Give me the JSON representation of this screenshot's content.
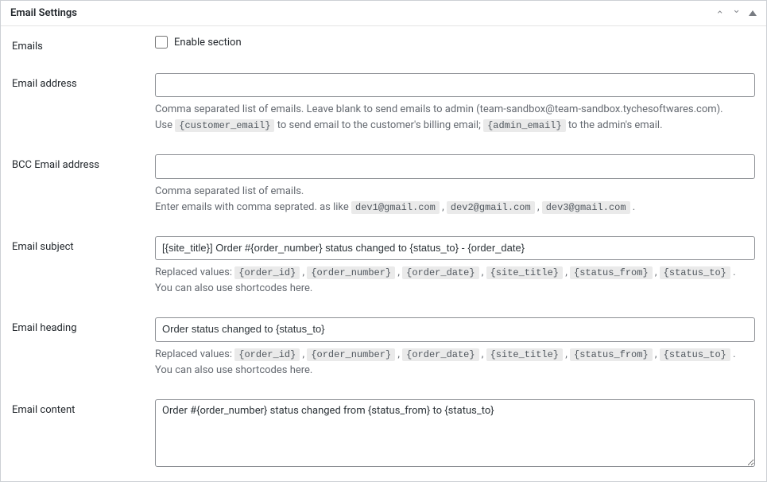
{
  "panel": {
    "title": "Email Settings"
  },
  "fields": {
    "emails_label": "Emails",
    "enable_section_label": "Enable section",
    "email_address_label": "Email address",
    "email_address_help_1": "Comma separated list of emails. Leave blank to send emails to admin (team-sandbox@team-sandbox.tychesoftwares.com).",
    "email_address_help_2a": "Use ",
    "email_address_help_2_code1": "{customer_email}",
    "email_address_help_2b": " to send email to the customer's billing email; ",
    "email_address_help_2_code2": "{admin_email}",
    "email_address_help_2c": " to the admin's email.",
    "bcc_label": "BCC Email address",
    "bcc_help_1": "Comma separated list of emails.",
    "bcc_help_2a": "Enter emails with comma seprated. as like ",
    "bcc_help_2_code1": "dev1@gmail.com",
    "bcc_help_2_code2": "dev2@gmail.com",
    "bcc_help_2_code3": "dev3@gmail.com",
    "subject_label": "Email subject",
    "subject_value": "[{site_title}] Order #{order_number} status changed to {status_to} - {order_date}",
    "heading_label": "Email heading",
    "heading_value": "Order status changed to {status_to}",
    "replaced_values_prefix": "Replaced values: ",
    "placeholders": [
      "{order_id}",
      "{order_number}",
      "{order_date}",
      "{site_title}",
      "{status_from}",
      "{status_to}"
    ],
    "replaced_values_suffix": ". You can also use shortcodes here.",
    "content_label": "Email content",
    "content_value": "Order #{order_number} status changed from {status_from} to {status_to}"
  }
}
